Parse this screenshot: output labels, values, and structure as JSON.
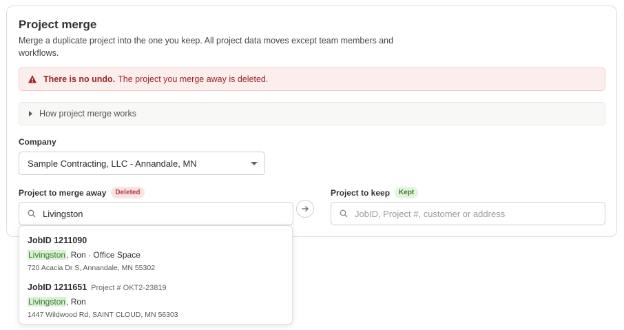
{
  "page": {
    "title": "Project merge",
    "description": "Merge a duplicate project into the one you keep. All project data moves except team members and workflows."
  },
  "alert": {
    "strong": "There is no undo.",
    "text": "The project you merge away is deleted.",
    "icon": "warning-icon",
    "color": "#9b2424"
  },
  "details": {
    "label": "How project merge works"
  },
  "company": {
    "label": "Company",
    "value": "Sample Contracting, LLC - Annandale, MN"
  },
  "merge_away": {
    "label": "Project to merge away",
    "badge": "Deleted",
    "search_value": "Livingston"
  },
  "keep": {
    "label": "Project to keep",
    "badge": "Kept",
    "placeholder": "JobID, Project #, customer or address"
  },
  "results": [
    {
      "job": "JobID 1211090",
      "project_no": "",
      "highlight": "Livingston",
      "rest": ", Ron · Office Space",
      "address": "720 Acacia Dr S, Annandale, MN 55302"
    },
    {
      "job": "JobID 1211651",
      "project_no": "Project # OKT2-23819",
      "highlight": "Livingston",
      "rest": ", Ron",
      "address": "1447 Wildwood Rd, SAINT CLOUD, MN 56303"
    }
  ]
}
